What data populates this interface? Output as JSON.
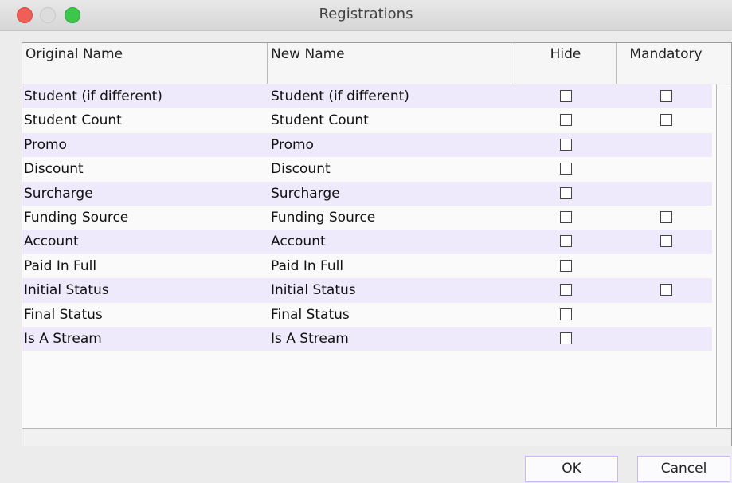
{
  "window": {
    "title": "Registrations"
  },
  "columns": {
    "original": "Original Name",
    "new": "New Name",
    "hide": "Hide",
    "mandatory": "Mandatory"
  },
  "rows": [
    {
      "original": "Student (if different)",
      "new": "Student (if different)",
      "hide": false,
      "mandatory": false,
      "has_mandatory": true
    },
    {
      "original": "Student Count",
      "new": "Student Count",
      "hide": false,
      "mandatory": false,
      "has_mandatory": true
    },
    {
      "original": "Promo",
      "new": "Promo",
      "hide": false,
      "has_mandatory": false
    },
    {
      "original": "Discount",
      "new": "Discount",
      "hide": false,
      "has_mandatory": false
    },
    {
      "original": "Surcharge",
      "new": "Surcharge",
      "hide": false,
      "has_mandatory": false
    },
    {
      "original": "Funding Source",
      "new": "Funding Source",
      "hide": false,
      "mandatory": false,
      "has_mandatory": true
    },
    {
      "original": "Account",
      "new": "Account",
      "hide": false,
      "mandatory": false,
      "has_mandatory": true
    },
    {
      "original": "Paid In Full",
      "new": "Paid In Full",
      "hide": false,
      "has_mandatory": false
    },
    {
      "original": "Initial Status",
      "new": "Initial Status",
      "hide": false,
      "mandatory": false,
      "has_mandatory": true
    },
    {
      "original": "Final Status",
      "new": "Final Status",
      "hide": false,
      "has_mandatory": false
    },
    {
      "original": "Is A Stream",
      "new": "Is A Stream",
      "hide": false,
      "has_mandatory": false
    }
  ],
  "buttons": {
    "ok": "OK",
    "cancel": "Cancel"
  }
}
